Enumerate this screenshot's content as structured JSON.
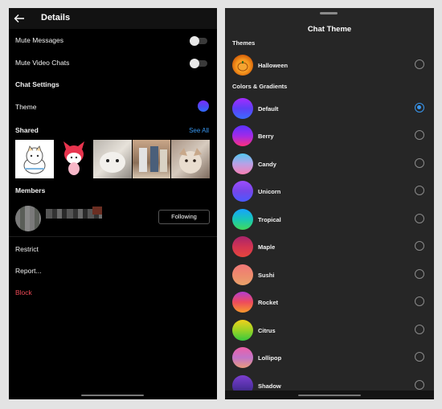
{
  "left": {
    "header": {
      "title": "Details",
      "back_icon": "back-arrow-icon"
    },
    "mute_messages": "Mute Messages",
    "mute_video_chats": "Mute Video Chats",
    "chat_settings": "Chat Settings",
    "theme": "Theme",
    "shared": {
      "title": "Shared",
      "see_all": "See All"
    },
    "members": {
      "title": "Members",
      "following_button": "Following"
    },
    "restrict": "Restrict",
    "report": "Report...",
    "block": "Block",
    "colors": {
      "link": "#3897f0",
      "danger": "#ed4956"
    }
  },
  "right": {
    "title": "Chat Theme",
    "section_themes": "Themes",
    "section_colors": "Colors & Gradients",
    "themes": [
      {
        "name": "Halloween",
        "selected": false
      }
    ],
    "colors": [
      {
        "name": "Default",
        "selected": true
      },
      {
        "name": "Berry",
        "selected": false
      },
      {
        "name": "Candy",
        "selected": false
      },
      {
        "name": "Unicorn",
        "selected": false
      },
      {
        "name": "Tropical",
        "selected": false
      },
      {
        "name": "Maple",
        "selected": false
      },
      {
        "name": "Sushi",
        "selected": false
      },
      {
        "name": "Rocket",
        "selected": false
      },
      {
        "name": "Citrus",
        "selected": false
      },
      {
        "name": "Lollipop",
        "selected": false
      },
      {
        "name": "Shadow",
        "selected": false
      }
    ]
  }
}
